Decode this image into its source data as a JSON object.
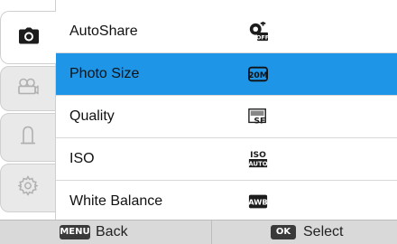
{
  "tabs": [
    {
      "name": "camera-icon",
      "active": true
    },
    {
      "name": "video-icon",
      "active": false
    },
    {
      "name": "user-icon",
      "active": false
    },
    {
      "name": "settings-icon",
      "active": false
    }
  ],
  "menu": {
    "items": [
      {
        "label": "AutoShare",
        "value_icon": "autoshare-off-icon",
        "value_text": "OFF"
      },
      {
        "label": "Photo Size",
        "value_icon": "photo-size-20m-icon",
        "value_text": "20M",
        "selected": true
      },
      {
        "label": "Quality",
        "value_icon": "quality-sf-icon",
        "value_text": "SF"
      },
      {
        "label": "ISO",
        "value_icon": "iso-auto-icon",
        "value_text": "ISO",
        "value_subtext": "AUTO"
      },
      {
        "label": "White Balance",
        "value_icon": "white-balance-awb-icon",
        "value_text": "AWB"
      }
    ]
  },
  "bottombar": {
    "back": {
      "key": "MENU",
      "label": "Back"
    },
    "select": {
      "key": "OK",
      "label": "Select"
    }
  },
  "colors": {
    "selected": "#1e95e6",
    "inactive_tab": "#e9e9e9",
    "bottombar": "#d9d9d9"
  }
}
